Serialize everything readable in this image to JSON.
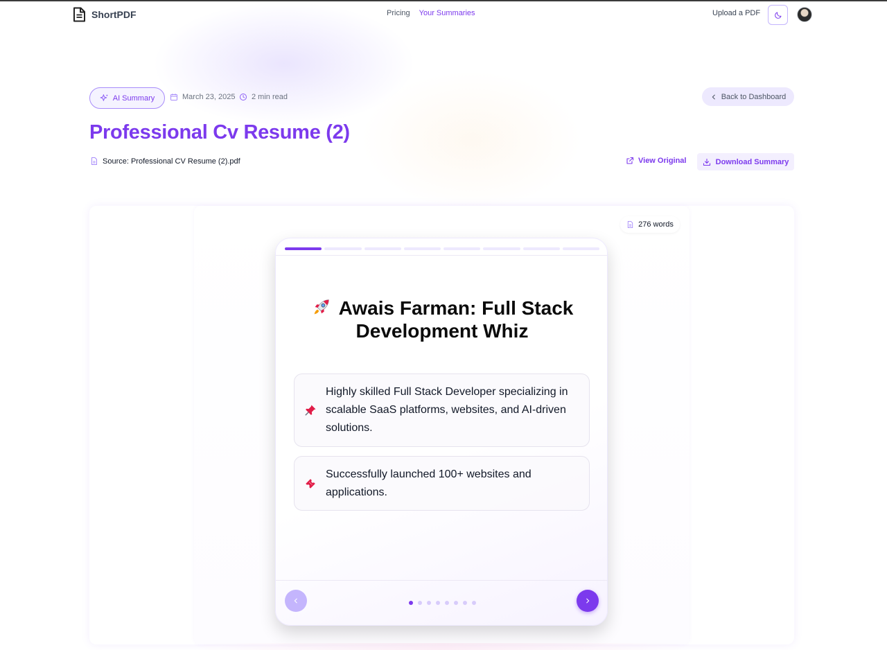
{
  "app": {
    "name": "ShortPDF"
  },
  "nav": {
    "pricing": "Pricing",
    "summaries": "Your Summaries",
    "upload": "Upload a PDF"
  },
  "meta": {
    "badge": "AI Summary",
    "date": "March 23, 2025",
    "read_time": "2 min read",
    "back": "Back to Dashboard"
  },
  "summary": {
    "title": "Professional Cv Resume (2)",
    "source": "Source: Professional CV Resume (2).pdf",
    "view_original": "View Original",
    "download": "Download Summary",
    "word_count": "276 words"
  },
  "slide": {
    "title": "Awais Farman: Full Stack Development Whiz",
    "title_icon": "rocket-icon",
    "points": [
      {
        "icon": "pushpin-icon",
        "text": "Highly skilled Full Stack Developer specializing in scalable SaaS platforms, websites, and AI-driven solutions."
      },
      {
        "icon": "ticket-icon",
        "text": "Successfully launched 100+ websites and applications."
      }
    ],
    "total_slides": 8,
    "current_slide": 1
  },
  "colors": {
    "accent": "#7c3aed",
    "accent_light": "#ede9fe",
    "text": "#111827",
    "muted": "#6b7280"
  }
}
